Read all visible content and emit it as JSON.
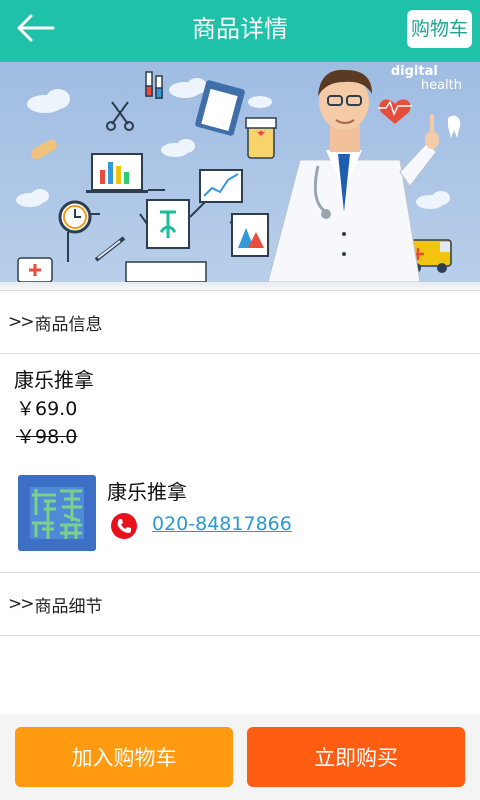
{
  "header": {
    "title": "商品详情",
    "cart_label": "购物车",
    "color": "#1fc2a8"
  },
  "banner": {
    "word_bold": "digital",
    "word_light": "health"
  },
  "sections": {
    "info_title": "商品信息",
    "detail_title": "商品细节",
    "chevrons": ">>"
  },
  "product": {
    "name": "康乐推拿",
    "price": "￥69.0",
    "old_price": "￥98.0"
  },
  "shop": {
    "name": "康乐推拿",
    "phone": "020-84817866"
  },
  "actions": {
    "add_to_cart": "加入购物车",
    "buy_now": "立即购买",
    "add_color": "#ff9a11",
    "buy_color": "#ff5d12"
  }
}
